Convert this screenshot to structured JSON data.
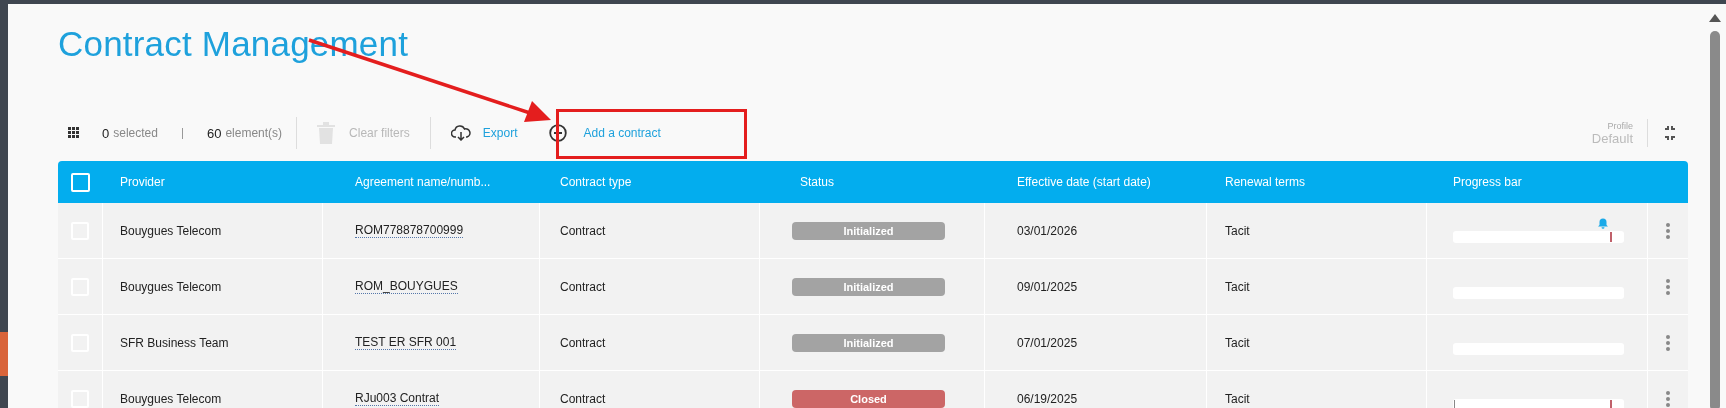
{
  "title": "Contract Management",
  "toolbar": {
    "selected_count": "0",
    "selected_label": "selected",
    "element_count": "60",
    "element_label": "element(s)",
    "clear_filters": {
      "label": "Clear filters",
      "disabled": true
    },
    "export": "Export",
    "add": "Add a contract"
  },
  "profile": {
    "label": "Profile",
    "value": "Default"
  },
  "table": {
    "all_checked": false,
    "columns": [
      "Provider",
      "Agreement name/numb...",
      "Contract type",
      "Status",
      "Effective date (start date)",
      "Renewal terms",
      "Progress bar"
    ],
    "rows": [
      {
        "checked": false,
        "provider": "Bouygues Telecom",
        "agreement": "ROM778878700999",
        "type": "Contract",
        "status": {
          "label": "Initialized",
          "color": "#a3a3a3"
        },
        "date": "03/01/2026",
        "renewal": "Tacit",
        "progress": {
          "due_marker": true,
          "alert": true,
          "start_marker": false
        }
      },
      {
        "checked": false,
        "provider": "Bouygues Telecom",
        "agreement": "ROM_BOUYGUES",
        "type": "Contract",
        "status": {
          "label": "Initialized",
          "color": "#a3a3a3"
        },
        "date": "09/01/2025",
        "renewal": "Tacit",
        "progress": {
          "due_marker": false,
          "alert": false,
          "start_marker": false
        }
      },
      {
        "checked": false,
        "provider": "SFR Business Team",
        "agreement": "TEST ER SFR 001",
        "type": "Contract",
        "status": {
          "label": "Initialized",
          "color": "#a3a3a3"
        },
        "date": "07/01/2025",
        "renewal": "Tacit",
        "progress": {
          "due_marker": false,
          "alert": false,
          "start_marker": false
        }
      },
      {
        "checked": false,
        "provider": "Bouygues Telecom",
        "agreement": "RJu003 Contrat",
        "type": "Contract",
        "status": {
          "label": "Closed",
          "color": "#cc6666"
        },
        "date": "06/19/2025",
        "renewal": "Tacit",
        "progress": {
          "due_marker": true,
          "alert": false,
          "start_marker": true
        }
      }
    ]
  }
}
